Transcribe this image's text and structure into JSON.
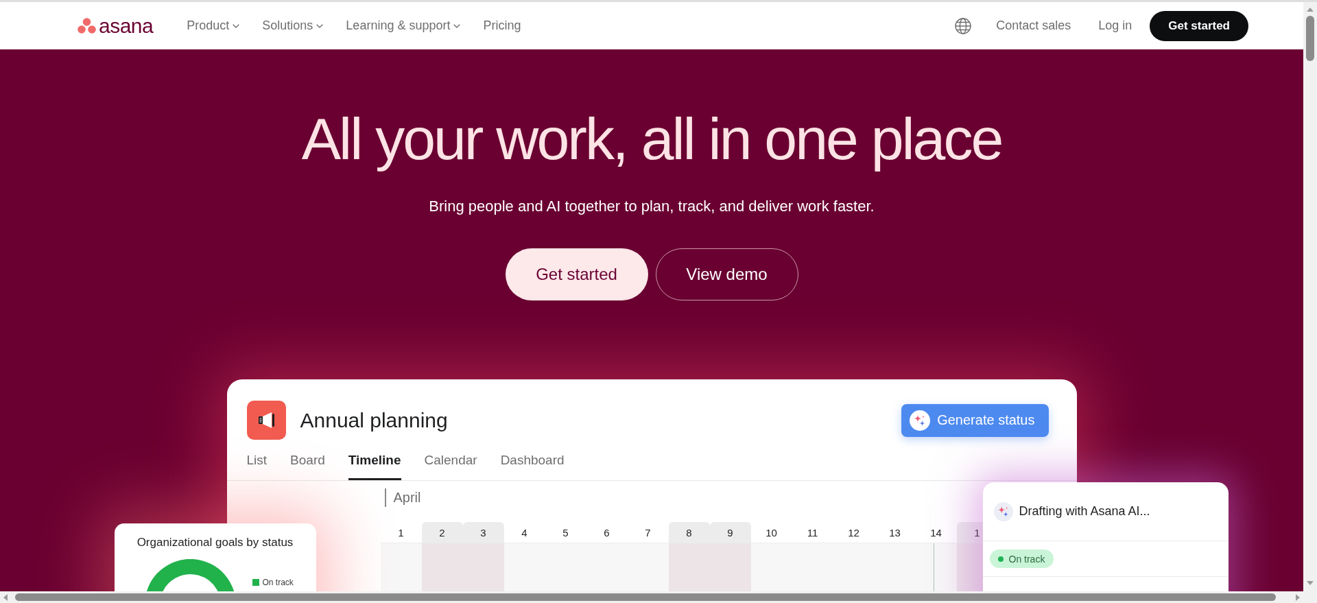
{
  "nav": {
    "logo": "asana",
    "items": [
      {
        "label": "Product",
        "dropdown": true
      },
      {
        "label": "Solutions",
        "dropdown": true
      },
      {
        "label": "Learning & support",
        "dropdown": true
      },
      {
        "label": "Pricing",
        "dropdown": false
      }
    ],
    "links": [
      "Contact sales",
      "Log in"
    ],
    "cta": "Get started"
  },
  "hero": {
    "title": "All your work, all in one place",
    "subtitle": "Bring people and AI together to plan, track, and deliver work faster.",
    "buttons": [
      {
        "label": "Get started",
        "kind": "primary"
      },
      {
        "label": "View demo",
        "kind": "outline"
      }
    ]
  },
  "project": {
    "title": "Annual planning",
    "action": "Generate status",
    "tabs": [
      {
        "label": "List",
        "selected": false
      },
      {
        "label": "Board",
        "selected": false
      },
      {
        "label": "Timeline",
        "selected": true
      },
      {
        "label": "Calendar",
        "selected": false
      },
      {
        "label": "Dashboard",
        "selected": false
      }
    ],
    "month": "April",
    "days": [
      {
        "label": "1",
        "weekend": false,
        "today": false
      },
      {
        "label": "2",
        "weekend": true,
        "today": false
      },
      {
        "label": "3",
        "weekend": true,
        "today": false
      },
      {
        "label": "4",
        "weekend": false,
        "today": false
      },
      {
        "label": "5",
        "weekend": false,
        "today": false
      },
      {
        "label": "6",
        "weekend": false,
        "today": false
      },
      {
        "label": "7",
        "weekend": false,
        "today": false
      },
      {
        "label": "8",
        "weekend": true,
        "today": false
      },
      {
        "label": "9",
        "weekend": true,
        "today": false
      },
      {
        "label": "10",
        "weekend": false,
        "today": false
      },
      {
        "label": "11",
        "weekend": false,
        "today": false
      },
      {
        "label": "12",
        "weekend": false,
        "today": false
      },
      {
        "label": "13",
        "weekend": false,
        "today": false
      },
      {
        "label": "14",
        "weekend": false,
        "today": true
      },
      {
        "label": "1",
        "weekend": true,
        "today": false
      }
    ]
  },
  "goals_card": {
    "title": "Organizational goals by status",
    "legend": [
      {
        "label": "On track",
        "color": "#22b24c"
      }
    ]
  },
  "ai_card": {
    "title": "Drafting with Asana AI...",
    "status": "On track"
  }
}
